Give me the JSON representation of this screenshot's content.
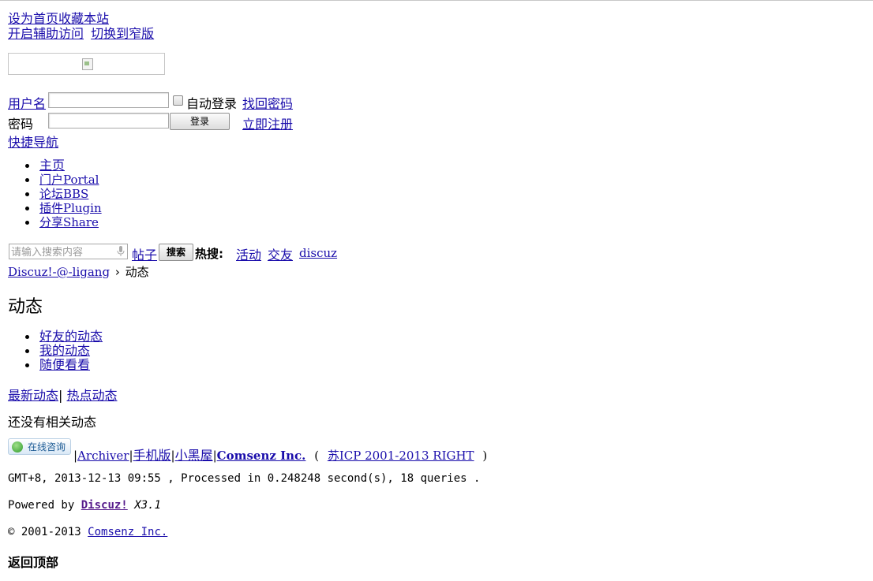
{
  "top_links": {
    "set_home": "设为首页",
    "bookmark": "收藏本站",
    "accessibility": "开启辅助访问",
    "narrow": "切换到窄版"
  },
  "login": {
    "username_label": "用户名",
    "username_value": "",
    "auto_login": "自动登录",
    "forgot": "找回密码",
    "password_label": "密码",
    "password_value": "",
    "login_button": "登录",
    "register": "立即注册"
  },
  "quick_nav": "快捷导航",
  "nav": {
    "items": [
      {
        "label": "主页"
      },
      {
        "label": "门户Portal"
      },
      {
        "label": "论坛BBS"
      },
      {
        "label": "插件Plugin"
      },
      {
        "label": "分享Share"
      }
    ]
  },
  "search": {
    "placeholder": "请输入搜索内容",
    "type": "帖子",
    "button": "搜索",
    "hot_label": "热搜:",
    "hot": [
      "活动",
      "交友",
      "discuz"
    ]
  },
  "breadcrumb": {
    "home": "Discuz!-@-ligang",
    "sep": "›",
    "current": "动态"
  },
  "page_title": "动态",
  "tabs": [
    {
      "label": "好友的动态"
    },
    {
      "label": "我的动态"
    },
    {
      "label": "随便看看"
    }
  ],
  "sort": {
    "latest": "最新动态",
    "sep": "|",
    "hot": "热点动态"
  },
  "empty_message": "还没有相关动态",
  "footer": {
    "online_badge": "在线咨询",
    "links": [
      "Archiver",
      "手机版",
      "小黑屋"
    ],
    "company": "Comsenz Inc.",
    "icp_open": "(",
    "icp": "苏ICP 2001-2013 RIGHT",
    "icp_close": ")",
    "stats": "GMT+8, 2013-12-13 09:55 , Processed in 0.248248 second(s), 18 queries .",
    "powered_prefix": "Powered by",
    "powered_link": "Discuz!",
    "version": "X3.1",
    "copyright_prefix": "© 2001-2013",
    "copyright_link": "Comsenz Inc.",
    "back_to_top": "返回顶部"
  }
}
